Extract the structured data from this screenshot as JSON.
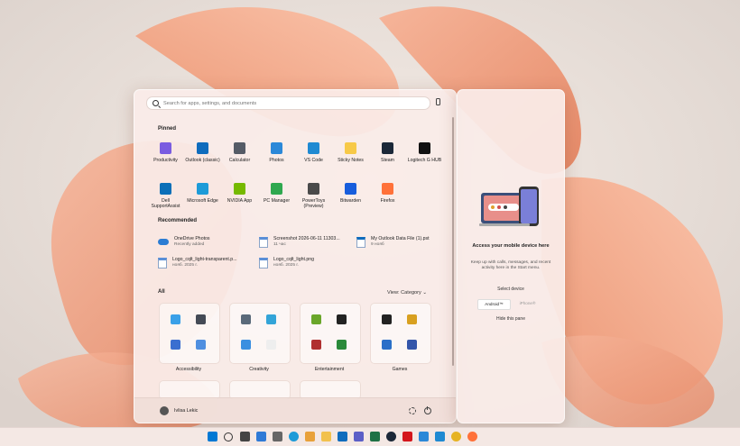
{
  "search": {
    "placeholder": "Search for apps, settings, and documents"
  },
  "pinned": {
    "title": "Pinned",
    "apps": [
      {
        "label": "Productivity",
        "icon": "productivity-folder-icon",
        "color": "#7a5ce0"
      },
      {
        "label": "Outlook (classic)",
        "icon": "outlook-icon",
        "color": "#0f6cbd"
      },
      {
        "label": "Calculator",
        "icon": "calculator-icon",
        "color": "#555b66"
      },
      {
        "label": "Photos",
        "icon": "photos-icon",
        "color": "#2b88d8"
      },
      {
        "label": "VS Code",
        "icon": "vscode-icon",
        "color": "#1f8ad2"
      },
      {
        "label": "Sticky Notes",
        "icon": "sticky-notes-icon",
        "color": "#f7c948"
      },
      {
        "label": "Steam",
        "icon": "steam-icon",
        "color": "#1b2838"
      },
      {
        "label": "Logitech G HUB",
        "icon": "logitech-icon",
        "color": "#111111"
      },
      {
        "label": "Dell SupportAssist",
        "icon": "dell-support-icon",
        "color": "#0b6fb8"
      },
      {
        "label": "Microsoft Edge",
        "icon": "edge-icon",
        "color": "#1d9bd8"
      },
      {
        "label": "NVIDIA App",
        "icon": "nvidia-icon",
        "color": "#76b900"
      },
      {
        "label": "PC Manager",
        "icon": "pc-manager-icon",
        "color": "#2fa84f"
      },
      {
        "label": "PowerToys (Preview)",
        "icon": "powertoys-icon",
        "color": "#4a4a4a"
      },
      {
        "label": "Bitwarden",
        "icon": "bitwarden-icon",
        "color": "#175ddc"
      },
      {
        "label": "Firefox",
        "icon": "firefox-icon",
        "color": "#ff7139"
      }
    ]
  },
  "recommended": {
    "title": "Recommended",
    "items": [
      {
        "title": "OneDrive Photos",
        "sub": "Recently added",
        "icon": "onedrive-icon"
      },
      {
        "title": "Screenshot 2026-06-11 11303...",
        "sub": "11 час",
        "icon": "image-file-icon"
      },
      {
        "title": "My Outlook Data File (1).pst",
        "sub": "9 нояб",
        "icon": "outlook-file-icon"
      },
      {
        "title": "Logo_cqlt_light-transparent.p...",
        "sub": "нояб. 2025 г.",
        "icon": "image-file-icon"
      },
      {
        "title": "Logo_cqlt_light.png",
        "sub": "нояб. 2025 г.",
        "icon": "image-file-icon"
      }
    ]
  },
  "all": {
    "title": "All",
    "view_label": "View: Category",
    "categories": [
      {
        "label": "Accessibility",
        "colors": [
          "#3aa0e8",
          "#444a55",
          "#3a6fd0",
          "#4f8fe0"
        ]
      },
      {
        "label": "Creativity",
        "colors": [
          "#5a6a7a",
          "#33a4d8",
          "#3b8fe0",
          "#eeeeee"
        ]
      },
      {
        "label": "Entertainment",
        "colors": [
          "#6aa62a",
          "#222222",
          "#b03030",
          "#2a8a3a"
        ]
      },
      {
        "label": "Games",
        "colors": [
          "#222222",
          "#d8a020",
          "#2a6fc8",
          "#3355aa"
        ]
      }
    ]
  },
  "user": {
    "name": "Ivlisa Lekic"
  },
  "phone_pane": {
    "title": "Access your mobile device here",
    "description": "Keep up with calls, messages, and recent activity here in the Start menu.",
    "select_label": "Select device",
    "android": "Android™",
    "iphone": "iPhone®",
    "hide": "Hide this pane"
  },
  "taskbar": {
    "icons": [
      "windows-start-icon",
      "search-icon",
      "task-view-icon",
      "widgets-icon",
      "settings-icon",
      "edge-icon",
      "files-icon",
      "folder-icon",
      "outlook-icon",
      "teams-icon",
      "excel-icon",
      "steam-icon",
      "acrobat-icon",
      "photos-icon",
      "vscode-icon",
      "chrome-icon",
      "firefox-icon"
    ],
    "colors": [
      "#0078d4",
      "#333333",
      "#444444",
      "#2f7ad6",
      "#666666",
      "#1d9bd8",
      "#e8a13a",
      "#f2c14e",
      "#0f6cbd",
      "#5b5fc7",
      "#1e7145",
      "#1b2838",
      "#d4161c",
      "#2b88d8",
      "#1f8ad2",
      "#e6b323",
      "#ff7139"
    ]
  }
}
